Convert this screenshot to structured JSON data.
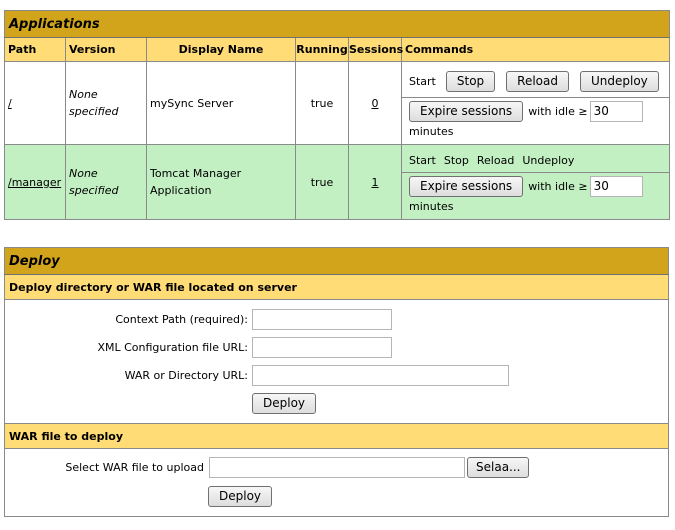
{
  "applications": {
    "title": "Applications",
    "columns": [
      "Path",
      "Version",
      "Display Name",
      "Running",
      "Sessions",
      "Commands"
    ],
    "rows": [
      {
        "path": "/",
        "version": "None specified",
        "display_name": "mySync Server",
        "running": "true",
        "sessions": "0",
        "commands": [
          "Start",
          "Stop",
          "Reload",
          "Undeploy"
        ],
        "expire_label": "Expire sessions",
        "idle_label": "with idle ≥",
        "idle_value": "30",
        "minutes_label": "minutes"
      },
      {
        "path": "/manager",
        "version": "None specified",
        "display_name": "Tomcat Manager Application",
        "running": "true",
        "sessions": "1",
        "commands": [
          "Start",
          "Stop",
          "Reload",
          "Undeploy"
        ],
        "expire_label": "Expire sessions",
        "idle_label": "with idle ≥",
        "idle_value": "30",
        "minutes_label": "minutes"
      }
    ]
  },
  "deploy": {
    "title": "Deploy",
    "server_section": {
      "header": "Deploy directory or WAR file located on server",
      "context_path_label": "Context Path (required):",
      "context_path_value": "",
      "xml_config_label": "XML Configuration file URL:",
      "xml_config_value": "",
      "war_dir_label": "WAR or Directory URL:",
      "war_dir_value": "",
      "deploy_button": "Deploy"
    },
    "war_section": {
      "header": "WAR file to deploy",
      "select_label": "Select WAR file to upload",
      "file_value": "",
      "browse_button": "Selaa...",
      "deploy_button": "Deploy"
    }
  }
}
